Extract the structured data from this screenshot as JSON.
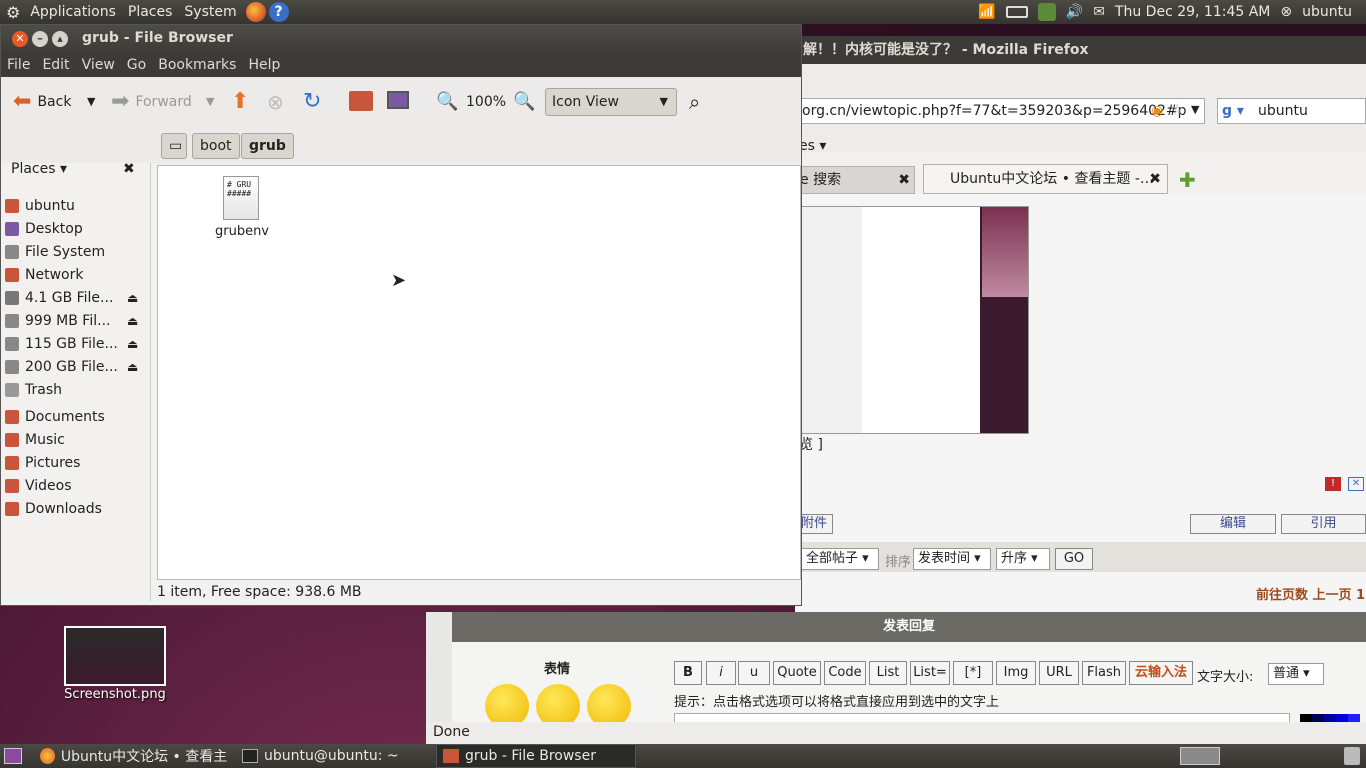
{
  "top_panel": {
    "menus": [
      "Applications",
      "Places",
      "System"
    ],
    "datetime": "Thu Dec 29, 11:45 AM",
    "user": "ubuntu"
  },
  "firefox": {
    "title": "解！！内核可能是没了？ - Mozilla Firefox",
    "url": "org.cn/viewtopic.php?f=77&t=359203&p=2596402#p",
    "search_value": "ubuntu",
    "bookmarks_label": "es ▾",
    "tab1_label": "e 搜索",
    "tab2_label": "Ubuntu中文论坛 • 查看主题 -…",
    "preview_suffix": "览 ]",
    "edit_label": "编辑",
    "quote_label": "引用",
    "attach_label": "附件",
    "filter_all": "全部帖子",
    "sort_label": "排序",
    "sort_by": "发表时间",
    "order": "升序",
    "go_label": "GO",
    "pagination": "前往页数 上一页 1,",
    "reply_header": "发表回复",
    "emoticons_label": "表情",
    "format_buttons": [
      "B",
      "i",
      "u",
      "Quote",
      "Code",
      "List",
      "List=",
      "[*]",
      "Img",
      "URL",
      "Flash"
    ],
    "cloud_ime": "云输入法",
    "font_size_label": "文字大小:",
    "font_size_value": "普通",
    "hint": "提示：点击格式选项可以将格式直接应用到选中的文字上",
    "status": "Done"
  },
  "file_browser": {
    "title": "grub - File Browser",
    "menus": [
      "File",
      "Edit",
      "View",
      "Go",
      "Bookmarks",
      "Help"
    ],
    "toolbar": {
      "back": "Back",
      "forward": "Forward",
      "zoom": "100%",
      "view_mode": "Icon View"
    },
    "path": [
      "boot",
      "grub"
    ],
    "places_label": "Places ▾",
    "sidebar_items": [
      {
        "label": "ubuntu",
        "icon": "home-icon",
        "color": "#c9553a"
      },
      {
        "label": "Desktop",
        "icon": "desktop-icon",
        "color": "#7a5aa0"
      },
      {
        "label": "File System",
        "icon": "drive-icon",
        "color": "#888"
      },
      {
        "label": "Network",
        "icon": "network-icon",
        "color": "#c9553a"
      },
      {
        "label": "4.1 GB File...",
        "icon": "usb-icon",
        "color": "#777",
        "eject": true
      },
      {
        "label": "999 MB Fil...",
        "icon": "drive-icon",
        "color": "#888",
        "eject": true
      },
      {
        "label": "115 GB File...",
        "icon": "drive-icon",
        "color": "#888",
        "eject": true
      },
      {
        "label": "200 GB File...",
        "icon": "drive-icon",
        "color": "#888",
        "eject": true
      },
      {
        "label": "Trash",
        "icon": "trash-icon",
        "color": "#999"
      },
      {
        "label": "Documents",
        "icon": "folder-icon",
        "color": "#c9553a"
      },
      {
        "label": "Music",
        "icon": "folder-icon",
        "color": "#c9553a"
      },
      {
        "label": "Pictures",
        "icon": "folder-icon",
        "color": "#c9553a"
      },
      {
        "label": "Videos",
        "icon": "folder-icon",
        "color": "#c9553a"
      },
      {
        "label": "Downloads",
        "icon": "folder-icon",
        "color": "#c9553a"
      }
    ],
    "files": [
      {
        "name": "grubenv",
        "preview": "# GRU\n#####"
      }
    ],
    "status": "1 item, Free space: 938.6 MB"
  },
  "desktop": {
    "icon_label": "Screenshot.png"
  },
  "taskbar": {
    "items": [
      "Ubuntu中文论坛 • 查看主…",
      "ubuntu@ubuntu: ~",
      "grub - File Browser"
    ]
  }
}
